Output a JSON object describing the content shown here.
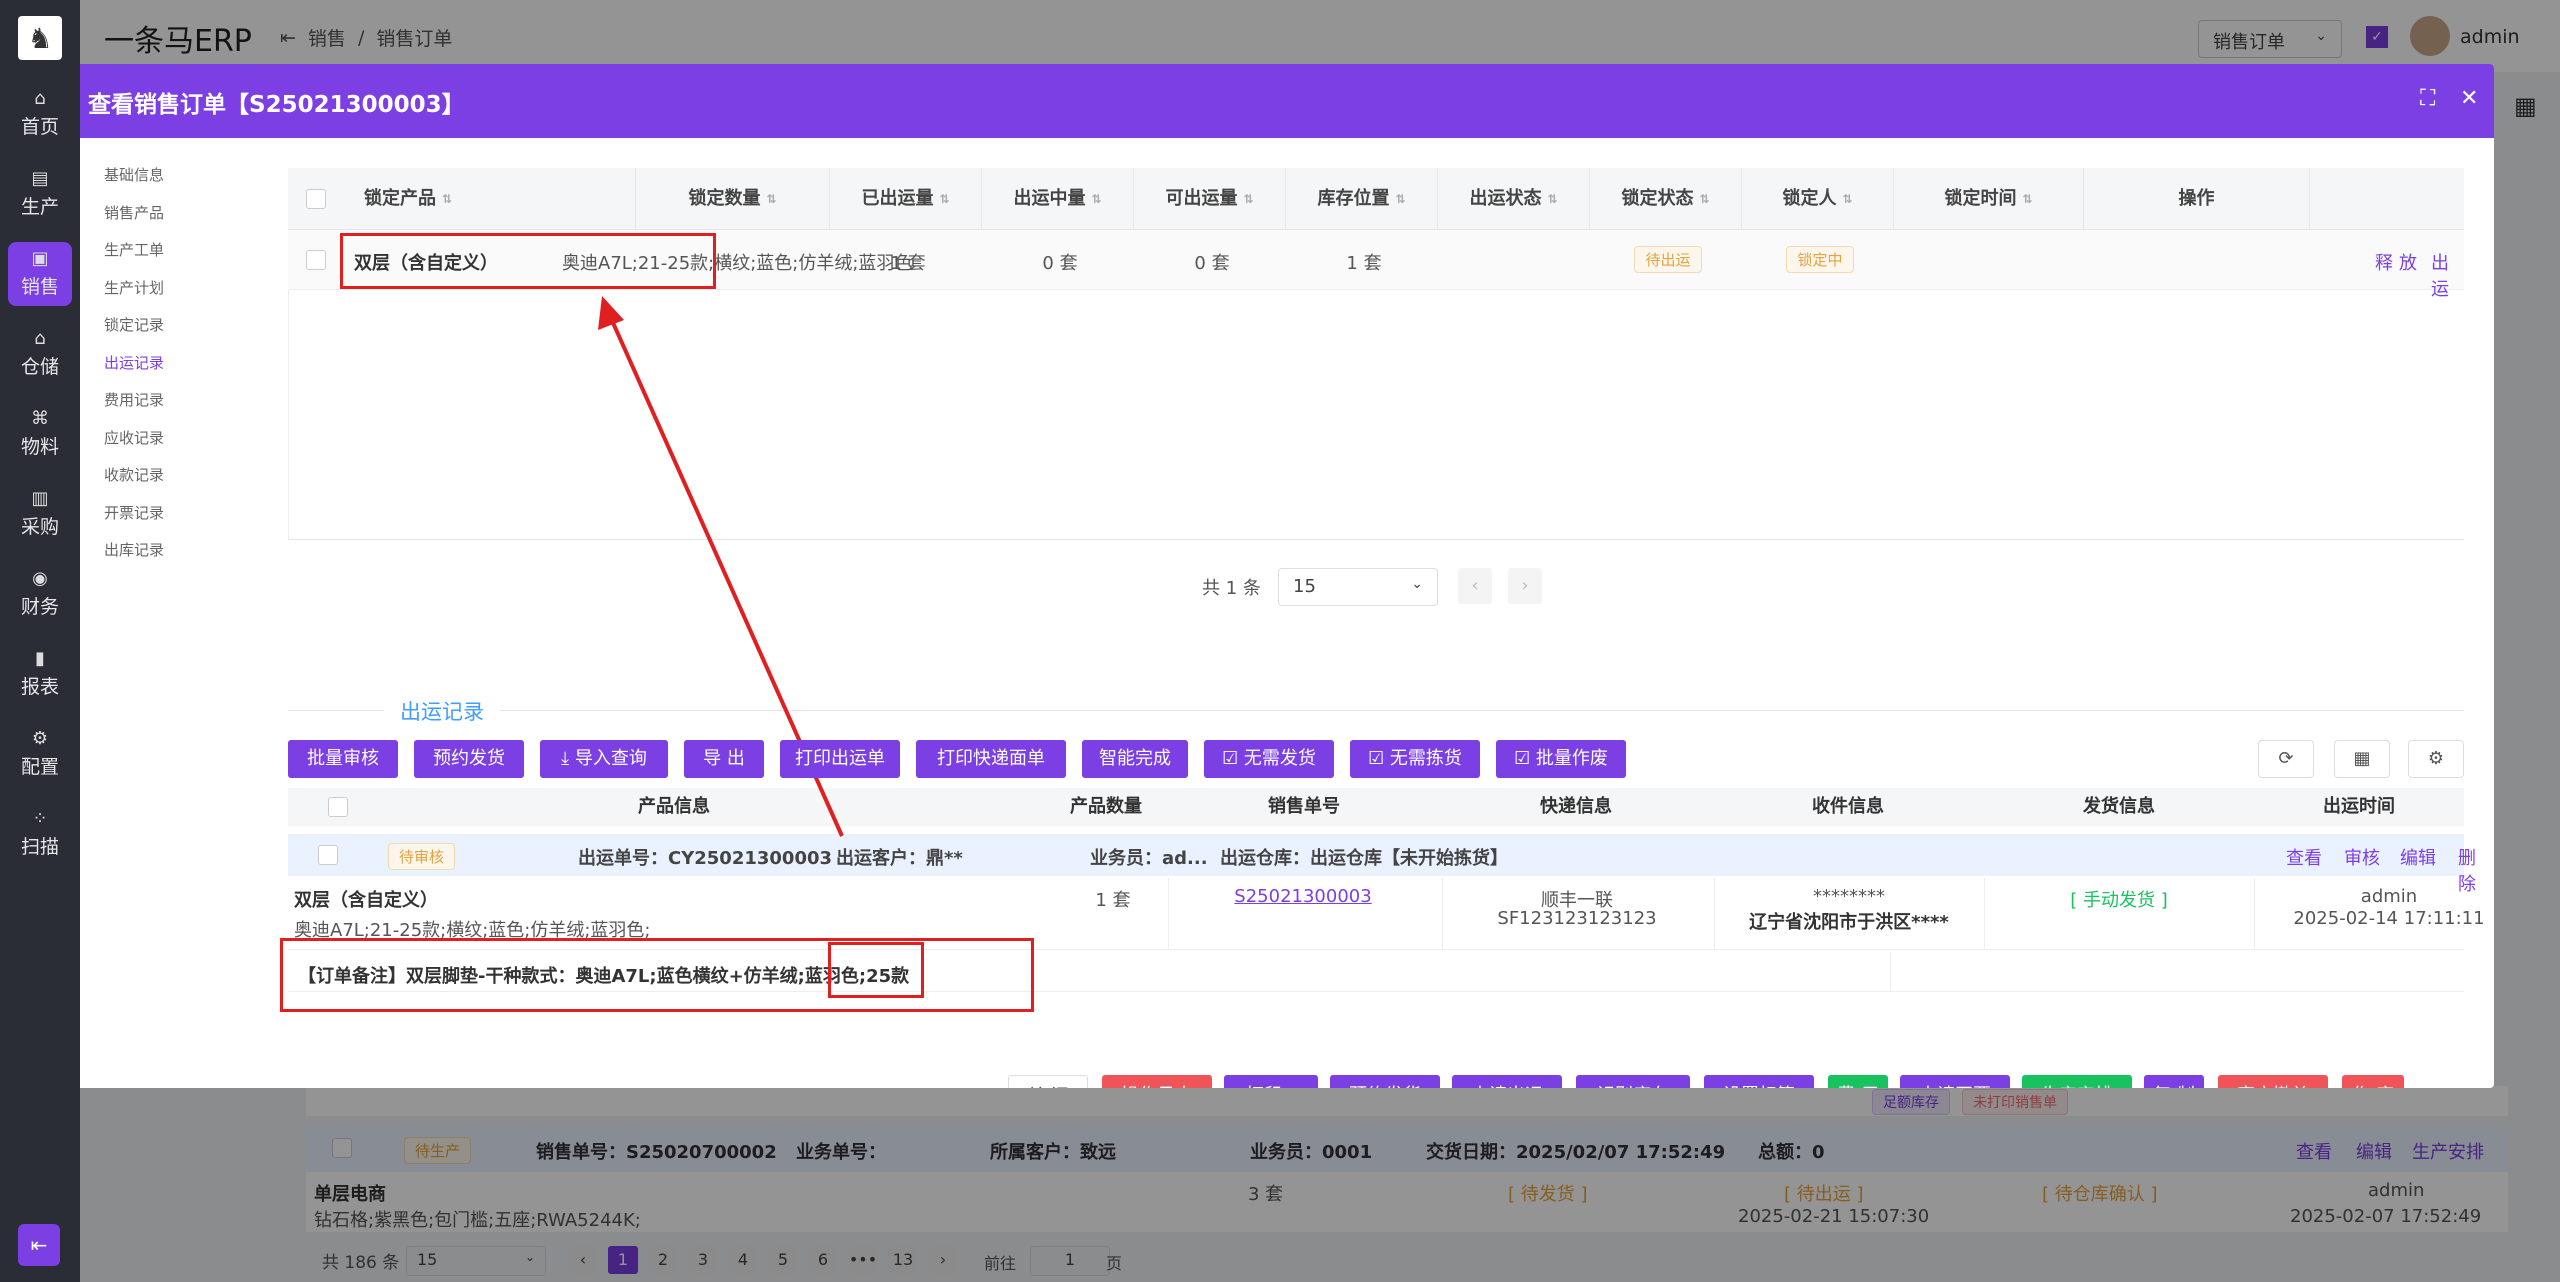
{
  "app": {
    "brand": "一条马ERP",
    "logo_icon": "horse-logo-icon"
  },
  "sidebar": {
    "items": [
      {
        "label": "首页",
        "icon": "home-icon",
        "glyph": "⌂"
      },
      {
        "label": "生产",
        "icon": "factory-icon",
        "glyph": "▤"
      },
      {
        "label": "销售",
        "icon": "sales-icon",
        "glyph": "▣"
      },
      {
        "label": "仓储",
        "icon": "warehouse-icon",
        "glyph": "⌂"
      },
      {
        "label": "物料",
        "icon": "material-icon",
        "glyph": "⌘"
      },
      {
        "label": "采购",
        "icon": "purchase-icon",
        "glyph": "▥"
      },
      {
        "label": "财务",
        "icon": "finance-icon",
        "glyph": "◉"
      },
      {
        "label": "报表",
        "icon": "report-icon",
        "glyph": "▮"
      },
      {
        "label": "配置",
        "icon": "config-icon",
        "glyph": "⚙"
      },
      {
        "label": "扫描",
        "icon": "scan-icon",
        "glyph": "⁘"
      }
    ],
    "active_index": 2,
    "collapse_glyph": "⇤"
  },
  "topbar": {
    "breadcrumb": [
      "销售",
      "销售订单"
    ],
    "collapse_glyph": "⇤",
    "menu_select": "销售订单",
    "user": "admin"
  },
  "background": {
    "row1": {
      "tags": [
        "足额库存",
        "未打印销售单"
      ]
    },
    "row2": {
      "status": "待生产",
      "order_no": "销售单号：S25020700002",
      "biz_no": "业务单号：",
      "customer": "所属客户：致远",
      "salesman": "业务员：0001",
      "trade_date": "交货日期：2025/02/07 17:52:49",
      "total": "总额：0",
      "actions": [
        "查看",
        "编辑",
        "生产安排"
      ],
      "product": "单层电商",
      "spec": "钻石格;紫黑色;包门槛;五座;RWA5244K;",
      "qty": "3 套",
      "s1": "[ 待发货 ]",
      "s2": "[ 待出运 ]",
      "s2_time": "2025-02-21 15:07:30",
      "s3": "[ 待仓库确认 ]",
      "user": "admin",
      "time": "2025-02-07 17:52:49"
    },
    "pager": {
      "total": "共 186 条",
      "size": "15",
      "pages": [
        "1",
        "2",
        "3",
        "4",
        "5",
        "6",
        "•••",
        "13"
      ],
      "goto": "前往",
      "goto_val": "1",
      "page_unit": "页"
    }
  },
  "modal": {
    "title": "查看销售订单【S25021300003】",
    "subnav": [
      "基础信息",
      "销售产品",
      "生产工单",
      "生产计划",
      "锁定记录",
      "出运记录",
      "费用记录",
      "应收记录",
      "收款记录",
      "开票记录",
      "出库记录"
    ],
    "subnav_active": 5,
    "lock_table": {
      "headers": [
        "锁定产品",
        "锁定数量",
        "已出运量",
        "出运中量",
        "可出运量",
        "库存位置",
        "出运状态",
        "锁定状态",
        "锁定人",
        "锁定时间",
        "操作"
      ],
      "row": {
        "product_name": "双层（含自定义）",
        "product_spec": "奥迪A7L;21-25款;横纹;蓝色;仿羊绒;蓝羽色",
        "lock_qty": "1 套",
        "shipped": "0 套",
        "shipping": "0 套",
        "available": "1 套",
        "location": "",
        "ship_status": "待出运",
        "lock_status": "锁定中",
        "locker": "",
        "lock_time": "",
        "actions": [
          "释放",
          "出运"
        ]
      },
      "pager": {
        "total": "共 1 条",
        "size": "15"
      }
    },
    "ship_section": {
      "title": "出运记录",
      "toolbar": [
        "批量审核",
        "预约发货",
        "导入查询",
        "导 出",
        "打印出运单",
        "打印快递面单",
        "智能完成",
        "无需发货",
        "无需拣货",
        "批量作废"
      ],
      "headers": [
        "产品信息",
        "产品数量",
        "销售单号",
        "快递信息",
        "收件信息",
        "发货信息",
        "出运时间"
      ],
      "group": {
        "status": "待审核",
        "ship_no": "出运单号：CY25021300003",
        "customer": "出运客户：鼎**",
        "salesman": "业务员：ad...",
        "warehouse": "出运仓库：出运仓库【未开始拣货】",
        "actions": [
          "查看",
          "审核",
          "编辑",
          "删除"
        ]
      },
      "row": {
        "product_name": "双层（含自定义）",
        "product_spec": "奥迪A7L;21-25款;横纹;蓝色;仿羊绒;蓝羽色;",
        "qty": "1 套",
        "order_no": "S25021300003",
        "express_company": "顺丰一联",
        "express_no": "SF123123123123",
        "receiver": "********",
        "address": "辽宁省沈阳市于洪区****",
        "delivery": "[ 手动发货 ]",
        "user": "admin",
        "time": "2025-02-14 17:11:11"
      },
      "note": "【订单备注】双层脚垫-干种款式：奥迪A7L;蓝色横纹+仿羊绒;蓝羽色;25款"
    },
    "footer": {
      "buttons": [
        {
          "label": "关 闭",
          "style": "white"
        },
        {
          "label": "操作日志",
          "style": "red"
        },
        {
          "label": "打印 ▴",
          "style": "purple"
        },
        {
          "label": "预约发货",
          "style": "purple"
        },
        {
          "label": "申请出运",
          "style": "purple"
        },
        {
          "label": "识别库存",
          "style": "purple"
        },
        {
          "label": "设置标签",
          "style": "purple"
        },
        {
          "label": "费 用",
          "style": "green"
        },
        {
          "label": "申请开票",
          "style": "purple"
        },
        {
          "label": "生产安排",
          "style": "green"
        },
        {
          "label": "复 制",
          "style": "purple"
        },
        {
          "label": "客户撤单",
          "style": "red"
        },
        {
          "label": "作 废",
          "style": "red"
        }
      ]
    }
  }
}
